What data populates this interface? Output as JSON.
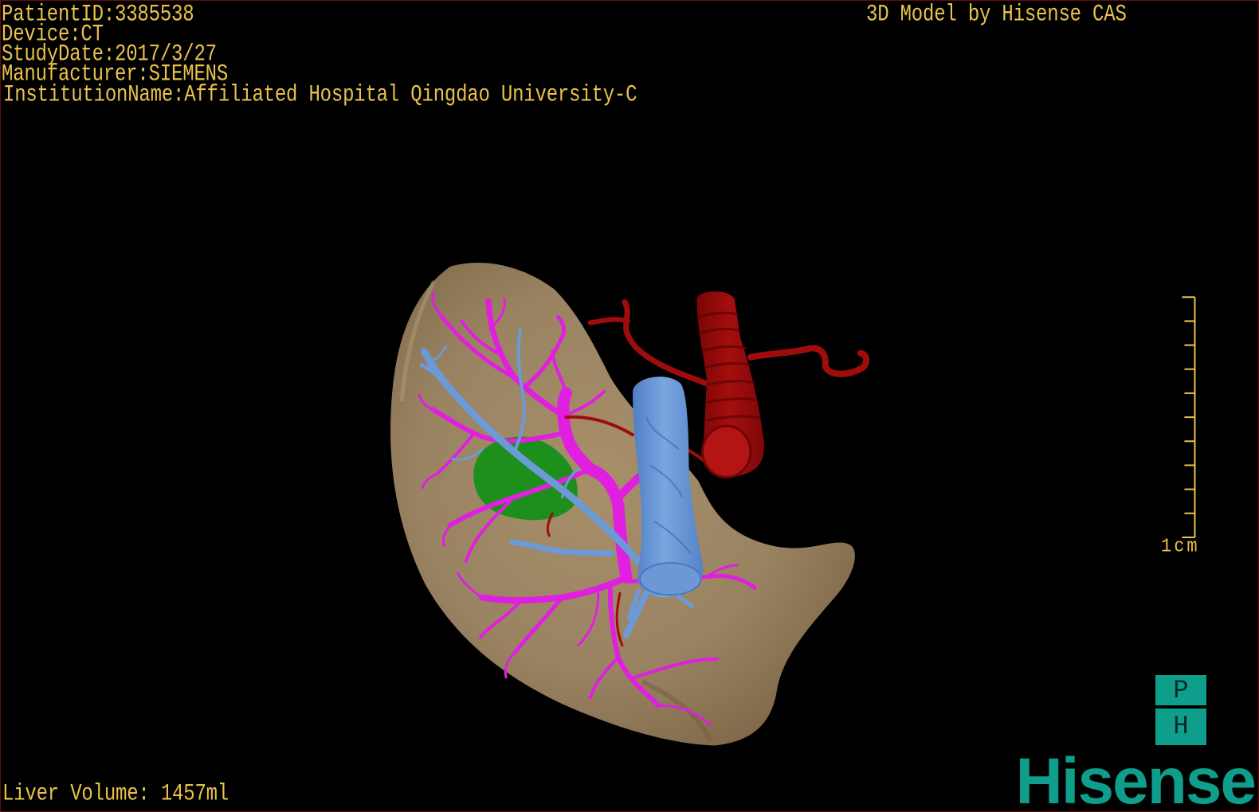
{
  "overlay": {
    "patient_id": "PatientID:3385538",
    "device": "Device:CT",
    "study_date": "StudyDate:2017/3/27",
    "manufacturer": "Manufacturer:SIEMENS",
    "institution_name": "InstitutionName:Affiliated Hospital Qingdao University-C",
    "model_credit": "3D Model by Hisense CAS",
    "liver_volume": "Liver Volume: 1457ml"
  },
  "scale_bar": {
    "label": "1cm"
  },
  "logo": {
    "badge_top": "P",
    "badge_bottom": "H",
    "wordmark": "Hisense"
  },
  "colors": {
    "background": "#000000",
    "frame": "#6a0d0d",
    "overlay_text": "#e8c24a",
    "liver": "#9a8362",
    "portal_vein": "#e01fe0",
    "hepatic_vein": "#6b9ad6",
    "artery": "#a00c0c",
    "gallbladder": "#1d8f1d",
    "logo": "#0e9e8b"
  }
}
